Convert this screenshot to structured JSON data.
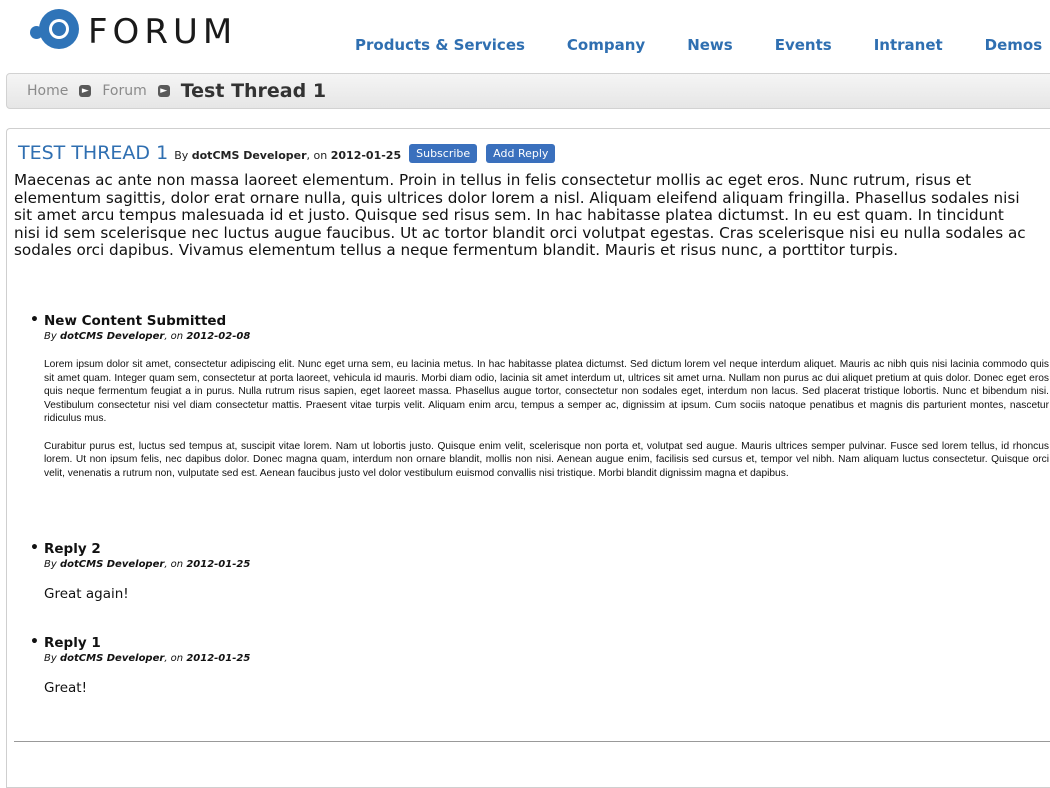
{
  "logo": {
    "text": "FORUM"
  },
  "nav": {
    "items": [
      {
        "label": "Products & Services"
      },
      {
        "label": "Company"
      },
      {
        "label": "News"
      },
      {
        "label": "Events"
      },
      {
        "label": "Intranet"
      },
      {
        "label": "Demos"
      }
    ]
  },
  "breadcrumb": {
    "home": "Home",
    "forum": "Forum",
    "current": "Test Thread 1"
  },
  "thread": {
    "title": "TEST THREAD 1",
    "by": "By",
    "author": "dotCMS Developer",
    "on": ", on",
    "date": "2012-01-25",
    "subscribe_label": "Subscribe",
    "add_reply_label": "Add Reply",
    "body": "Maecenas ac ante non massa laoreet elementum. Proin in tellus in felis consectetur mollis ac eget eros. Nunc rutrum, risus et elementum sagittis, dolor erat ornare nulla, quis ultrices dolor lorem a nisl. Aliquam eleifend aliquam fringilla. Phasellus sodales nisi sit amet arcu tempus malesuada id et justo. Quisque sed risus sem. In hac habitasse platea dictumst. In eu est quam. In tincidunt nisi id sem scelerisque nec luctus augue faucibus. Ut ac tortor blandit orci volutpat egestas. Cras scelerisque nisi eu nulla sodales ac sodales orci dapibus. Vivamus elementum tellus a neque fermentum blandit. Mauris et risus nunc, a porttitor turpis."
  },
  "replies": [
    {
      "title": "New Content Submitted",
      "by": "By",
      "author": "dotCMS Developer",
      "on": ", on",
      "date": "2012-02-08",
      "paragraphs": [
        "Lorem ipsum dolor sit amet, consectetur adipiscing elit. Nunc eget urna sem, eu lacinia metus. In hac habitasse platea dictumst. Sed dictum lorem vel neque interdum aliquet. Mauris ac nibh quis nisi lacinia commodo quis sit amet quam. Integer quam sem, consectetur at porta laoreet, vehicula id mauris. Morbi diam odio, lacinia sit amet interdum ut, ultrices sit amet urna. Nullam non purus ac dui aliquet pretium at quis dolor. Donec eget eros quis neque fermentum feugiat a in purus. Nulla rutrum risus sapien, eget laoreet massa. Phasellus augue tortor, consectetur non sodales eget, interdum non lacus. Sed placerat tristique lobortis. Nunc et bibendum nisi. Vestibulum consectetur nisi vel diam consectetur mattis. Praesent vitae turpis velit. Aliquam enim arcu, tempus a semper ac, dignissim at ipsum. Cum sociis natoque penatibus et magnis dis parturient montes, nascetur ridiculus mus.",
        "Curabitur purus est, luctus sed tempus at, suscipit vitae lorem. Nam ut lobortis justo. Quisque enim velit, scelerisque non porta et, volutpat sed augue. Mauris ultrices semper pulvinar. Fusce sed lorem tellus, id rhoncus lorem. Ut non ipsum felis, nec dapibus dolor. Donec magna quam, interdum non ornare blandit, mollis non nisi. Aenean augue enim, facilisis sed cursus et, tempor vel nibh. Nam aliquam luctus consectetur. Quisque orci velit, venenatis a rutrum non, vulputate sed est. Aenean faucibus justo vel dolor vestibulum euismod convallis nisi tristique. Morbi blandit dignissim magna et dapibus."
      ]
    },
    {
      "title": "Reply 2",
      "by": "By",
      "author": "dotCMS Developer",
      "on": ", on",
      "date": "2012-01-25",
      "text": "Great again!"
    },
    {
      "title": "Reply 1",
      "by": "By",
      "author": "dotCMS Developer",
      "on": ", on",
      "date": "2012-01-25",
      "text": "Great!"
    }
  ],
  "colors": {
    "brand": "#2f74b8",
    "link": "#2f6fb1",
    "button": "#3a70bd"
  }
}
